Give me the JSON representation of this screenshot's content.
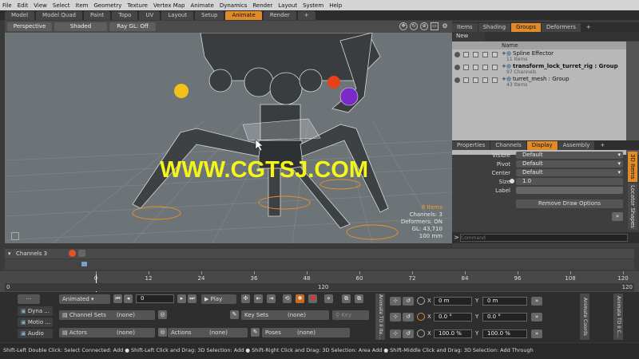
{
  "menu": [
    "File",
    "Edit",
    "View",
    "Select",
    "Item",
    "Geometry",
    "Texture",
    "Vertex Map",
    "Animate",
    "Dynamics",
    "Render",
    "Layout",
    "System",
    "Help"
  ],
  "layout_tabs": [
    {
      "label": "Model",
      "active": false
    },
    {
      "label": "Model Quad",
      "active": false
    },
    {
      "label": "Paint",
      "active": false
    },
    {
      "label": "Topo",
      "active": false
    },
    {
      "label": "UV",
      "active": false
    },
    {
      "label": "Layout",
      "active": false
    },
    {
      "label": "Setup",
      "active": false
    },
    {
      "label": "Animate",
      "active": true
    },
    {
      "label": "Render",
      "active": false
    }
  ],
  "viewport": {
    "view_label": "Perspective",
    "shading_label": "Shaded",
    "raygl_label": "Ray GL: Off",
    "stats": {
      "items": "8 Items",
      "channels": "Channels: 3",
      "deformers": "Deformers: ON",
      "gl": "GL: 43,710",
      "scale": "100 mm"
    }
  },
  "watermark": "WWW.CGTSJ.COM",
  "items_panel": {
    "tabs": [
      {
        "label": "Items",
        "active": false
      },
      {
        "label": "Shading",
        "active": false
      },
      {
        "label": "Groups",
        "active": true
      },
      {
        "label": "Deformers",
        "active": false
      }
    ],
    "new_group_label": "New Group",
    "column_name": "Name",
    "rows": [
      {
        "name": "Spline Effector",
        "sub": "11 Items"
      },
      {
        "name": "transform_lock_turret_rig : Group",
        "sub": "97 Channels"
      },
      {
        "name": "turret_mesh : Group",
        "sub": "43 Items"
      }
    ]
  },
  "props_panel": {
    "tabs": [
      {
        "label": "Properties",
        "active": false
      },
      {
        "label": "Channels",
        "active": false
      },
      {
        "label": "Display",
        "active": true
      },
      {
        "label": "Assembly",
        "active": false
      }
    ],
    "rows": [
      {
        "label": "Visible",
        "value": "Default"
      },
      {
        "label": "Pivot",
        "value": "Default"
      },
      {
        "label": "Center",
        "value": "Default"
      },
      {
        "label": "Size",
        "value": "1.0"
      },
      {
        "label": "Label",
        "value": ""
      }
    ],
    "remove_draw_label": "Remove Draw Options",
    "command_placeholder": "Command",
    "side_tabs": [
      "3D Items",
      "Locator Shapes"
    ]
  },
  "timeline": {
    "channels_label": "Channels 3",
    "ticks": [
      "0",
      "12",
      "24",
      "36",
      "48",
      "60",
      "72",
      "84",
      "96",
      "108",
      "120"
    ],
    "range_start": "0",
    "range_mid": "120",
    "range_end": "120"
  },
  "transport": {
    "mode_label": "Animated",
    "frame_value": "0",
    "play_label": "Play",
    "channel_sets_label": "Channel Sets",
    "channel_sets_value": "(none)",
    "key_sets_label": "Key Sets",
    "key_sets_value": "(none)",
    "key_label": "Key",
    "actors_label": "Actors",
    "actors_value": "(none)",
    "actions_label": "Actions",
    "actions_value": "(none)",
    "poses_label": "Poses",
    "poses_value": "(none)"
  },
  "left_tools": [
    "Dyna ...",
    "Motio ...",
    "Audio"
  ],
  "vertical_tabs": {
    "tool_item": "Animate TD II Ite...",
    "coords": "Animate Coords",
    "tool_c": "Animate TD II C..."
  },
  "transform": {
    "pos_x": "0 m",
    "pos_y": "0 m",
    "rot_x": "0.0 °",
    "rot_y": "0.0 °",
    "scl_x": "100.0 %",
    "scl_y": "100.0 %"
  },
  "status_bar": "Shift-Left Double Click: Select Connected: Add ● Shift-Left Click and Drag: 3D Selection: Add ● Shift-Right Click and Drag: 3D Selection: Area Add ● Shift-Middle Click and Drag: 3D Selection: Add Through",
  "colors": {
    "accent": "#e08a2a",
    "menubar": "#d4d4d4",
    "viewport": "#6d7478",
    "watermark": "#f5f51a"
  }
}
